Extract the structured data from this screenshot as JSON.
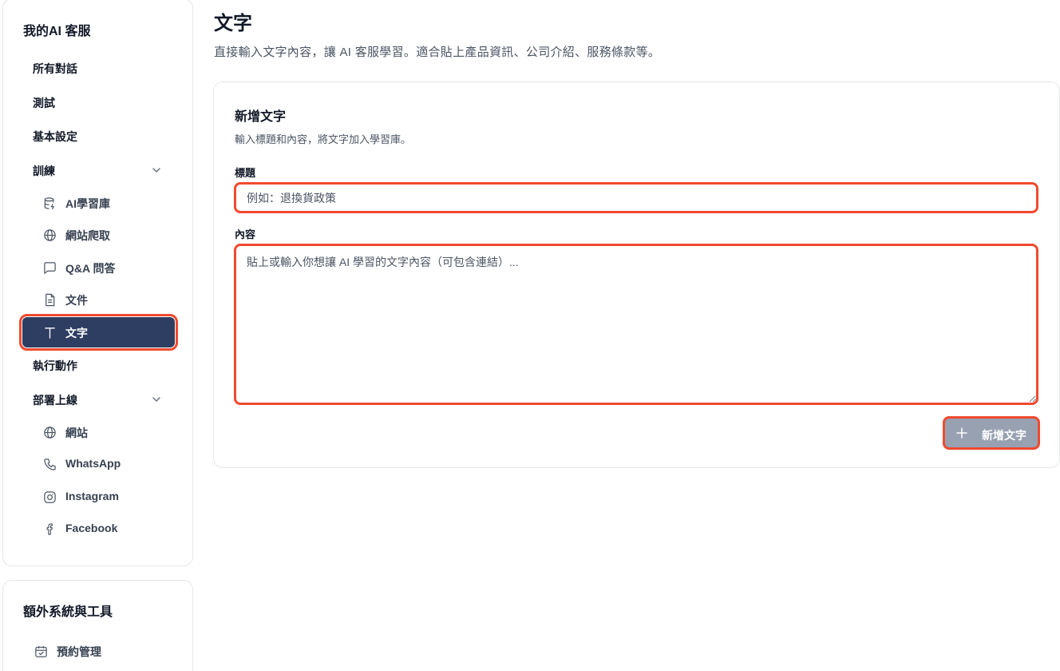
{
  "sidebar": {
    "title": "我的AI 客服",
    "items": {
      "all_chats": "所有對話",
      "test": "測試",
      "basic_settings": "基本設定",
      "training": "訓練",
      "ai_library": "AI學習庫",
      "web_crawl": "網站爬取",
      "qa": "Q&A 問答",
      "documents": "文件",
      "text": "文字",
      "actions": "執行動作",
      "deploy": "部署上線",
      "website": "網站",
      "whatsapp": "WhatsApp",
      "instagram": "Instagram",
      "facebook": "Facebook"
    }
  },
  "extra": {
    "title": "額外系統與工具",
    "booking": "預約管理"
  },
  "main": {
    "title": "文字",
    "description": "直接輸入文字內容，讓 AI 客服學習。適合貼上產品資訊、公司介紹、服務條款等。"
  },
  "form": {
    "title": "新增文字",
    "subtitle": "輸入標題和內容，將文字加入學習庫。",
    "title_label": "標題",
    "title_placeholder": "例如：退換貨政策",
    "content_label": "內容",
    "content_placeholder": "貼上或輸入你想讓 AI 學習的文字內容（可包含連結）...",
    "submit_label": "新增文字"
  },
  "colors": {
    "active_bg": "#2e3e63",
    "highlight": "#f04a2f",
    "button_disabled": "#97a1b2"
  }
}
